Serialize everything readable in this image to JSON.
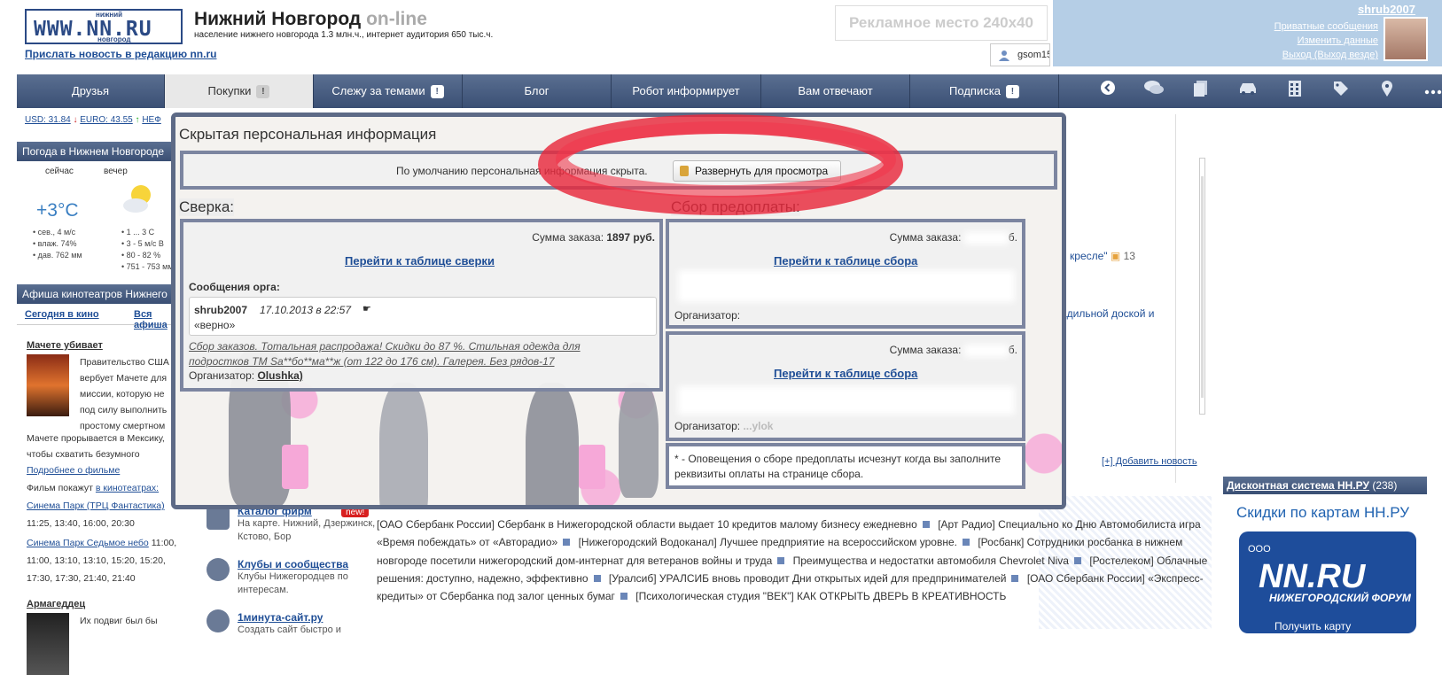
{
  "header": {
    "logo_top": "нижний",
    "logo_main": "WWW.NN.RU",
    "logo_bottom": "новгород",
    "title_main": "Нижний Новгород",
    "title_suffix": "on-line",
    "subtitle": "население нижнего новгорода 1.3 млн.ч., интернет аудитория 650 тыс.ч.",
    "send_news": "Прислать новость в редакцию nn.ru",
    "ad_text": "Рекламное место 240x40",
    "user_chip": "gsom15"
  },
  "userbar": {
    "username": "shrub2007",
    "links": [
      "Приватные сообщения",
      "Изменить данные",
      "Выход (Выход везде)"
    ]
  },
  "nav": {
    "items": [
      {
        "label": "Друзья",
        "badge": ""
      },
      {
        "label": "Покупки",
        "badge": "!"
      },
      {
        "label": "Слежу за темами",
        "badge": "!"
      },
      {
        "label": "Блог",
        "badge": ""
      },
      {
        "label": "Робот информирует",
        "badge": ""
      },
      {
        "label": "Вам отвечают",
        "badge": ""
      },
      {
        "label": "Подписка",
        "badge": "!"
      }
    ],
    "icons": [
      "back-icon",
      "chat-icon",
      "pages-icon",
      "car-icon",
      "building-icon",
      "tag-icon",
      "location-icon",
      "more-icon"
    ]
  },
  "rates": {
    "usd": "USD: 31.84",
    "euro": "EURO: 43.55",
    "more": "НЕФ"
  },
  "weather": {
    "title": "Погода в Нижнем Новгороде",
    "now_label": "сейчас",
    "evening_label": "вечер",
    "temp": "+3°С",
    "now_details": [
      "сев., 4 м/с",
      "влаж. 74%",
      "дав. 762 мм"
    ],
    "evening_details": [
      "1 ... 3 С",
      "3 - 5 м/с В",
      "80 - 82 %",
      "751 - 753 мм"
    ]
  },
  "cinema": {
    "title": "Афиша кинотеатров Нижнего Новгорода",
    "tab_today": "Сегодня в кино",
    "tab_all": "Вся афиша",
    "movie1_title": "Мачете убивает",
    "movie1_text": [
      "Правительство США",
      "вербует Мачете для",
      "миссии, которую не",
      "под силу выполнить",
      "простому смертном"
    ],
    "movie1_text2": [
      "Мачете прорывается в Мексику,",
      "чтобы схватить безумного"
    ],
    "more_link": "Подробнее о фильме",
    "shows_label": "Фильм покажут",
    "shows_link": "в кинотеатрах:",
    "cinema1": "Синема Парк (ТРЦ Фантастика)",
    "cinema1_times": "11:25, 13:40, 16:00, 20:30",
    "cinema2": "Синема Парк Седьмое небо",
    "cinema2_times_1": "11:00,",
    "cinema2_times_2": "11:00, 13:10, 13:10, 15:20, 15:20,",
    "cinema2_times_3": "17:30, 17:30, 21:40, 21:40",
    "movie2_title": "Армагеддец",
    "movie2_text": [
      "Их подвиг был бы"
    ]
  },
  "middle": {
    "catalog_title": "Каталог фирм",
    "catalog_badge": "new!",
    "catalog_sub": [
      "На карте. Нижний, Дзержинск,",
      "Кстово, Бор"
    ],
    "clubs_title": "Клубы и сообщества",
    "clubs_sub": [
      "Клубы Нижегородцев по",
      "интересам."
    ],
    "minute_title": "1минута-сайт.ру",
    "minute_sub": [
      "Создать сайт быстро и"
    ]
  },
  "ticker": [
    "[ОАО Сбербанк России] Сбербанк в Нижегородской области выдает 10 кредитов малому бизнесу ежедневно",
    "[Арт Радио] Специально ко Дню Автомобилиста игра «Время побеждать» от «Авторадио»",
    "[Нижегородский Водоканал] Лучшее предприятие на всероссийском уровне.",
    "[Росбанк] Сотрудники росбанка в нижнем новгороде посетили нижегородский дом-интернат для ветеранов войны и труда",
    "Преимущества и недостатки автомобиля Chevrolet Niva",
    "[Ростелеком] Облачные решения: доступно, надежно, эффективно",
    "[Уралсиб] УРАЛСИБ вновь проводит Дни открытых идей для предпринимателей",
    "[ОАО Сбербанк России] «Экспресс-кредиты» от Сбербанка под залог ценных бумаг",
    "[Психологическая студия \"ВЕК\"] КАК ОТКРЫТЬ ДВЕРЬ В КРЕАТИВНОСТЬ"
  ],
  "right_side": {
    "frag1": "и кресле\"",
    "frag1_count": "13",
    "frag2": "адильной доской и",
    "frag2b": "и",
    "add_news": "[+] Добавить новость",
    "discount_link": "Дисконтная система НН.РУ",
    "discount_count": "(238)",
    "discount_title": "Скидки по картам НН.РУ",
    "card_ooo": "ООО",
    "card_big": "NN.RU",
    "card_small": "НИЖЕГОРОДСКИЙ ФОРУМ",
    "card_get": "Получить карту"
  },
  "modal": {
    "title": "Скрытая персональная информация",
    "hidden_text": "По умолчанию персональная информация скрыта.",
    "expand_button": "Развернуть для просмотра",
    "sverka": {
      "heading": "Сверка:",
      "sum_label": "Сумма заказа:",
      "sum_value": "1897 руб.",
      "link": "Перейти к таблице сверки",
      "messages_label": "Сообщения орга:",
      "msg_author": "shrub2007",
      "msg_date": "17.10.2013 в 22:57",
      "msg_text": "«верно»",
      "desc": "Сбор заказов. Тотальная распродажа! Скидки до 87 %. Стильная одежда для подростков ТМ Sa**бо**ма**ж (от 122 до 176 см). Галерея. Без рядов-17",
      "org_label": "Организатор:",
      "org_name": "Olushka)"
    },
    "sbor": {
      "heading": "Сбор предоплаты:",
      "sum_label": "Сумма заказа:",
      "sum_tail": "б.",
      "link": "Перейти к таблице сбора",
      "org_label": "Организатор:",
      "org_partial_1": "",
      "org_partial_2": "...ylok"
    },
    "note": "* - Оповещения о сборе предоплаты исчезнут когда вы заполните реквизиты оплаты на странице сбора."
  }
}
